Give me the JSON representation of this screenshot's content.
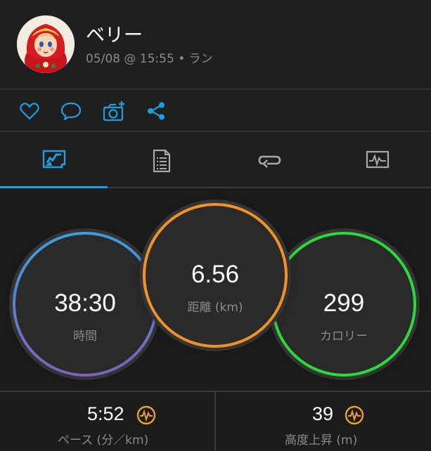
{
  "header": {
    "user_name": "ベリー",
    "activity_meta": "05/08 @ 15:55 • ラン"
  },
  "actions": [
    "heart-icon",
    "comment-icon",
    "add-photo-icon",
    "share-icon"
  ],
  "tabs": [
    "overview-icon",
    "details-icon",
    "laps-icon",
    "charts-icon"
  ],
  "selected_tab": 0,
  "stats": {
    "time": {
      "value": "38:30",
      "label": "時間"
    },
    "distance": {
      "value": "6.56",
      "label": "距離 (km)"
    },
    "calories": {
      "value": "299",
      "label": "カロリー"
    }
  },
  "bottom": {
    "pace": {
      "value": "5:52",
      "label": "ペース (分／km)"
    },
    "elevation": {
      "value": "39",
      "label": "高度上昇 (m)"
    }
  },
  "colors": {
    "accent": "#1ba0e2",
    "time_ring_top": "#3a9fe0",
    "time_ring_bottom": "#7d62b8",
    "distance_ring": "#f0922a",
    "calories_ring": "#2cd93c",
    "metric_icon": "#f0a030"
  }
}
